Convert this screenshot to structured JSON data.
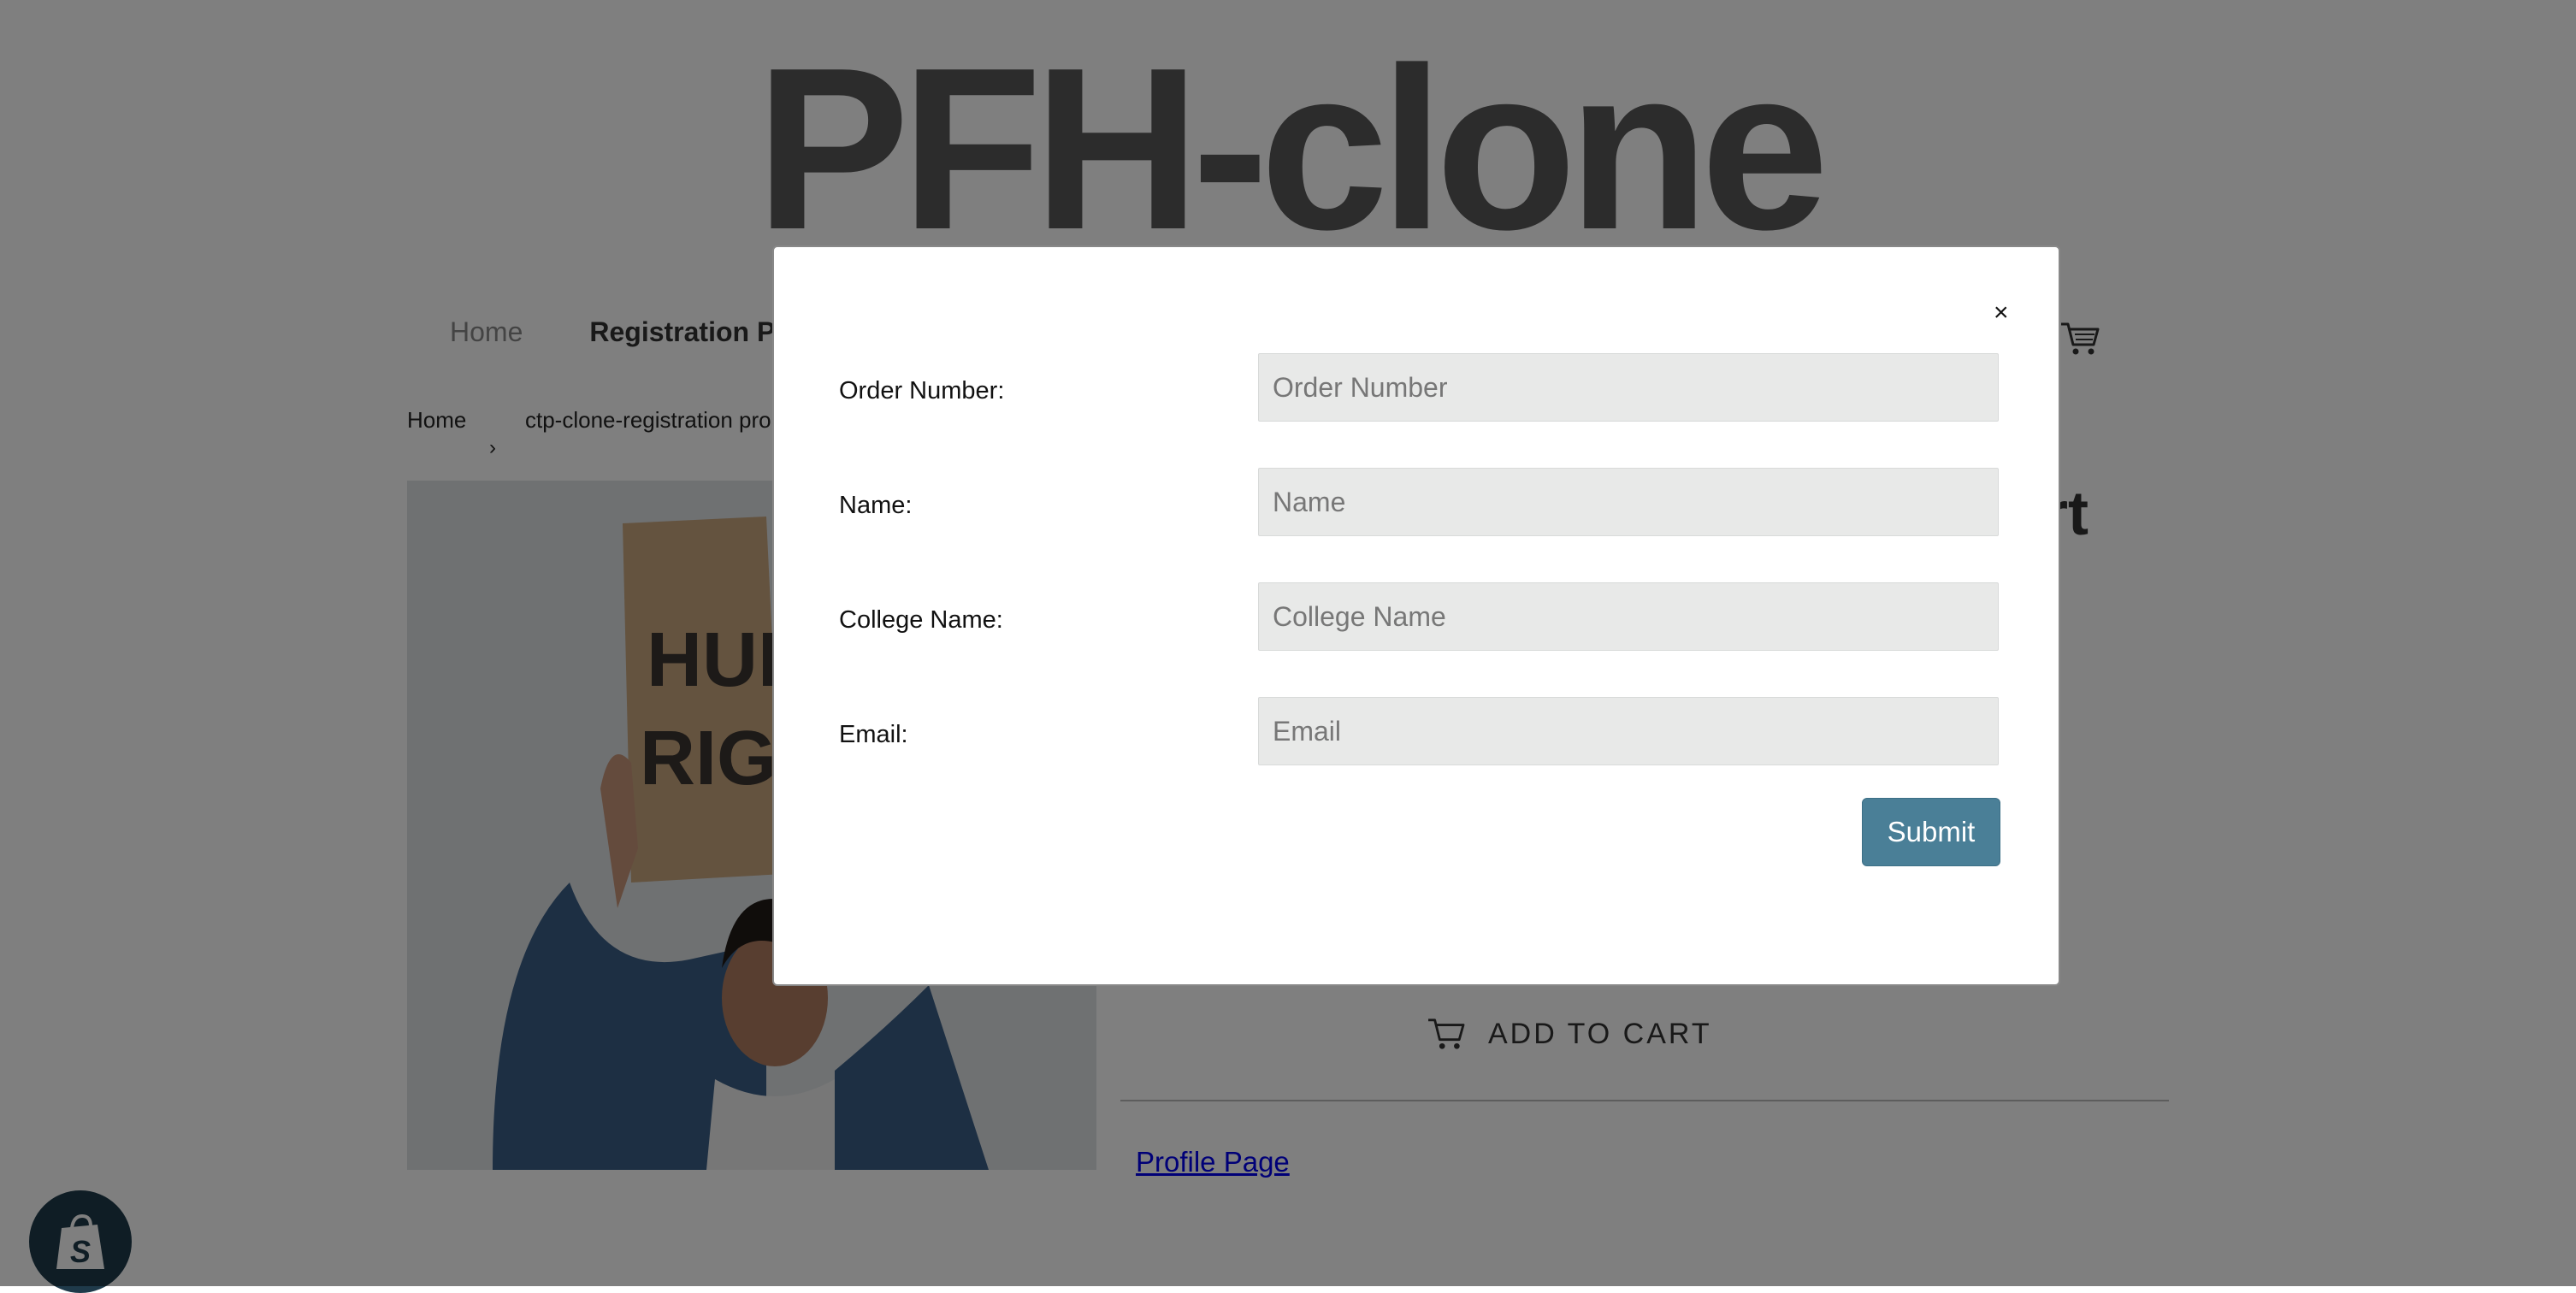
{
  "store": {
    "title": "PFH-clone",
    "nav": [
      "Home",
      "Registration P"
    ],
    "breadcrumb": {
      "home": "Home",
      "separator": "›",
      "current": "ctp-clone-registration pro"
    },
    "product_title_fragment": "rt",
    "sign_text": [
      "HUM",
      "RIGH"
    ],
    "add_to_cart": "ADD TO CART",
    "profile_link": "Profile Page"
  },
  "modal": {
    "close": "×",
    "fields": [
      {
        "label": "Order Number:",
        "placeholder": "Order Number",
        "value": ""
      },
      {
        "label": "Name:",
        "placeholder": "Name",
        "value": ""
      },
      {
        "label": "College Name:",
        "placeholder": "College Name",
        "value": ""
      },
      {
        "label": "Email:",
        "placeholder": "Email",
        "value": ""
      }
    ],
    "submit": "Submit"
  },
  "colors": {
    "submit": "#4a7f97",
    "input_bg": "#e8e9e8",
    "overlay": "rgba(0,0,0,0.5)"
  },
  "icons": [
    "cart-icon",
    "shopify-bag-icon",
    "close-icon"
  ]
}
